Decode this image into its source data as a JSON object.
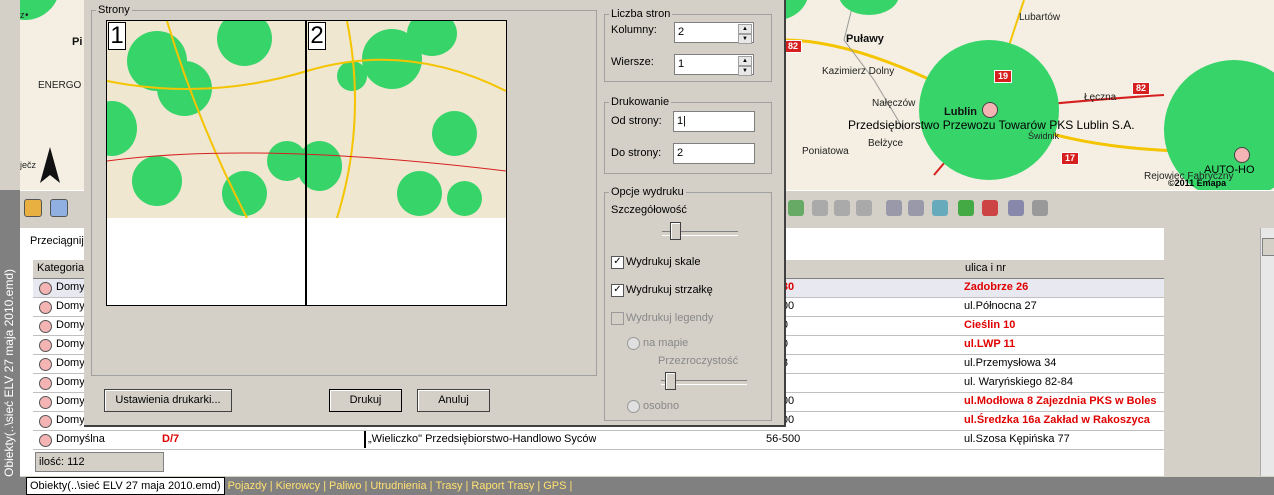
{
  "map_left": {
    "labels": [
      "Pi",
      "ENERGO",
      "ječz"
    ],
    "letter_z": "z"
  },
  "map_right": {
    "cities": {
      "lublin": "Lublin",
      "pulawy": "Puławy"
    },
    "towns": [
      "Lubartów",
      "Kazimierz Dolny",
      "Nałęczów",
      "Łęczna",
      "Świdnik",
      "Poniatowa",
      "Bełżyce",
      "Rejowiec Fabryczny"
    ],
    "road_signs": [
      "19",
      "82",
      "17",
      "82"
    ],
    "poi_label": "Przedsiębiorstwo Przewozu Towarów PKS Lublin S.A.",
    "poi_label2": "AUTO-HO",
    "copyright": "©2011 Emapa"
  },
  "dialog": {
    "strony_legend": "Strony",
    "page_numbers": [
      "1",
      "2"
    ],
    "liczba_stron_legend": "Liczba stron",
    "kolumny_label": "Kolumny:",
    "kolumny_value": "2",
    "wiersze_label": "Wiersze:",
    "wiersze_value": "1",
    "drukowanie_legend": "Drukowanie",
    "od_strony_label": "Od strony:",
    "od_strony_value": "1|",
    "do_strony_label": "Do strony:",
    "do_strony_value": "2",
    "opcje_legend": "Opcje wydruku",
    "szczegolowosc_label": "Szczegółowość",
    "szczegolowosc_level": 0.12,
    "wydrukuj_skale": "Wydrukuj skale",
    "wydrukuj_strzalke": "Wydrukuj strzałkę",
    "wydrukuj_legendy": "Wydrukuj legendy",
    "na_mapie": "na mapie",
    "przezroczystosc_label": "Przezroczystość",
    "przezroczystosc_level": 0.05,
    "osobno": "osobno",
    "ustawienia_button": "Ustawienia drukarki...",
    "drukuj_button": "Drukuj",
    "anuluj_button": "Anuluj"
  },
  "list": {
    "drag_hint": "Przeciągnij",
    "col_kategoria": "Kategoria",
    "col_ulica": "ulica i nr",
    "rows": [
      {
        "kategoria": "Domy",
        "kod": "3-230",
        "ulica": "Zadobrze 26",
        "red": true
      },
      {
        "kategoria": "Domy",
        "kod": "5-400",
        "ulica": "ul.Północna 27",
        "red": false
      },
      {
        "kategoria": "Domy",
        "kod": "-100",
        "ulica": "Cieślin 10",
        "red": true
      },
      {
        "kategoria": "Domy",
        "kod": "-200",
        "ulica": "ul.LWP 11",
        "red": true
      },
      {
        "kategoria": "Domy",
        "kod": "-758",
        "ulica": "ul.Przemysłowa 34",
        "red": false
      },
      {
        "kategoria": "Domy",
        "kod": "300",
        "ulica": "ul. Waryńskiego 82-84",
        "red": false
      },
      {
        "kategoria": "Domy",
        "kod": "9-700",
        "ulica": "ul.Modłowa 8  Zajezdnia PKS w Boles",
        "red": true
      },
      {
        "kategoria": "Domy",
        "kod": "5-300",
        "ulica": "ul.Średzka 16a  Zakład w Rakoszyca",
        "red": true
      }
    ],
    "last_row": {
      "kategoria": "Domyślna",
      "id": "D/7",
      "nazwa": "„Wieliczko\" Przedsiębiorstwo-Handlowo",
      "miasto": "Syców",
      "kod": "56-500",
      "ulica": "ul.Szosa Kępińska 77"
    },
    "count_label": "ilość:  112"
  },
  "side_tab": "Obiekty(..\\sieć ELV 27 maja 2010.emd)",
  "bottom_tabs": [
    "Obiekty(..\\sieć ELV 27 maja 2010.emd)",
    "Pojazdy",
    "Kierowcy",
    "Paliwo",
    "Utrudnienia",
    "Trasy",
    "Raport Trasy",
    "GPS"
  ]
}
